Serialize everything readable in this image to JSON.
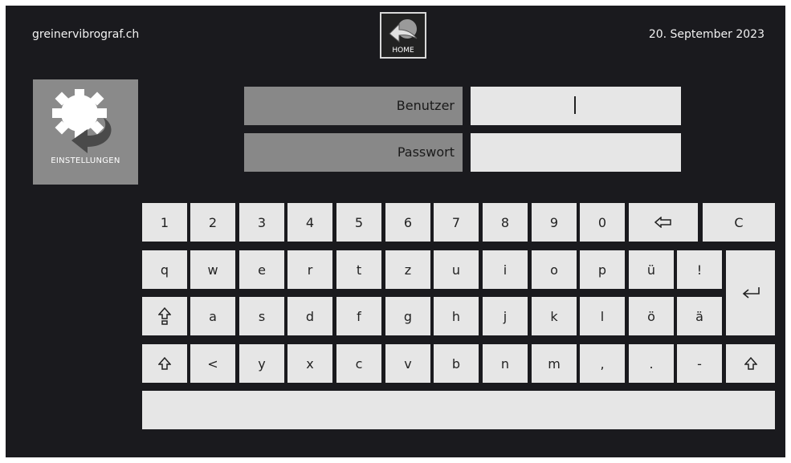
{
  "header": {
    "brand": "greinervibrograf.ch",
    "date": "20. September 2023",
    "home_label": "HOME"
  },
  "settings": {
    "label": "EINSTELLUNGEN"
  },
  "login": {
    "user_label": "Benutzer",
    "user_value": "",
    "password_label": "Passwort",
    "password_value": ""
  },
  "keyboard": {
    "row1": [
      "1",
      "2",
      "3",
      "4",
      "5",
      "6",
      "7",
      "8",
      "9",
      "0"
    ],
    "backspace_icon": "backspace-arrow-icon",
    "clear": "C",
    "row2": [
      "q",
      "w",
      "e",
      "r",
      "t",
      "z",
      "u",
      "i",
      "o",
      "p",
      "ü",
      "!"
    ],
    "enter_icon": "enter-icon",
    "caps_icon": "caps-lock-icon",
    "row3": [
      "a",
      "s",
      "d",
      "f",
      "g",
      "h",
      "j",
      "k",
      "l",
      "ö",
      "ä"
    ],
    "shift_icon": "shift-icon",
    "row4": [
      "<",
      "y",
      "x",
      "c",
      "v",
      "b",
      "n",
      "m",
      ",",
      ".",
      "-"
    ]
  },
  "colors": {
    "background": "#1a1a1e",
    "key": "#e6e6e6",
    "field_label": "#888888",
    "settings_tile": "#8a8a8a"
  }
}
